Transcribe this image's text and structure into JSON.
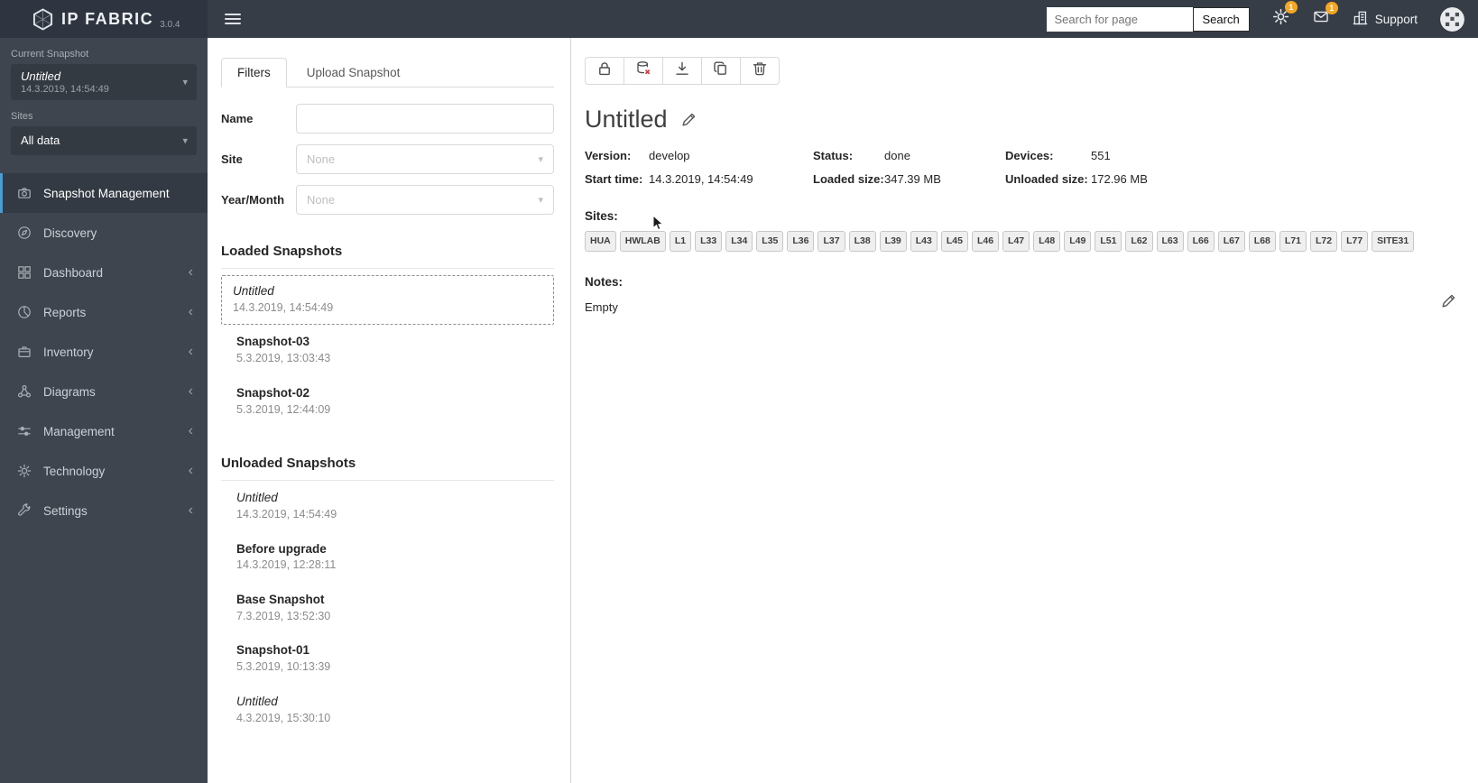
{
  "colors": {
    "accent": "#4a9bd5",
    "badge": "#f5a623",
    "danger": "#cf3b3b",
    "topbar_bg": "#363d46",
    "sidebar_bg": "#3e454e"
  },
  "icons": {
    "caret": "▾",
    "chevron": "‹"
  },
  "topbar": {
    "logo_text": "IP FABRIC",
    "version": "3.0.4",
    "search_placeholder": "Search for page",
    "search_button": "Search",
    "gear_badge": "1",
    "mail_badge": "1",
    "support_label": "Support"
  },
  "sidebar": {
    "current_snapshot_label": "Current Snapshot",
    "snapshot_select": {
      "name": "Untitled",
      "date": "14.3.2019, 14:54:49"
    },
    "sites_label": "Sites",
    "sites_select_value": "All data",
    "items": [
      {
        "label": "Snapshot Management"
      },
      {
        "label": "Discovery"
      },
      {
        "label": "Dashboard"
      },
      {
        "label": "Reports"
      },
      {
        "label": "Inventory"
      },
      {
        "label": "Diagrams"
      },
      {
        "label": "Management"
      },
      {
        "label": "Technology"
      },
      {
        "label": "Settings"
      }
    ]
  },
  "panel": {
    "tabs": [
      {
        "label": "Filters"
      },
      {
        "label": "Upload Snapshot"
      }
    ],
    "form": {
      "name_label": "Name",
      "site_label": "Site",
      "site_value": "None",
      "yearmonth_label": "Year/Month",
      "yearmonth_value": "None"
    },
    "loaded_heading": "Loaded Snapshots",
    "loaded": [
      {
        "name": "Untitled",
        "date": "14.3.2019, 14:54:49"
      },
      {
        "name": "Snapshot-03",
        "date": "5.3.2019, 13:03:43"
      },
      {
        "name": "Snapshot-02",
        "date": "5.3.2019, 12:44:09"
      }
    ],
    "unloaded_heading": "Unloaded Snapshots",
    "unloaded": [
      {
        "name": "Untitled",
        "date": "14.3.2019, 14:54:49"
      },
      {
        "name": "Before upgrade",
        "date": "14.3.2019, 12:28:11"
      },
      {
        "name": "Base Snapshot",
        "date": "7.3.2019, 13:52:30"
      },
      {
        "name": "Snapshot-01",
        "date": "5.3.2019, 10:13:39"
      },
      {
        "name": "Untitled",
        "date": "4.3.2019, 15:30:10"
      }
    ]
  },
  "main": {
    "title": "Untitled",
    "details": [
      {
        "label": "Version:",
        "value": "develop"
      },
      {
        "label": "Status:",
        "value": "done"
      },
      {
        "label": "Devices:",
        "value": "551"
      },
      {
        "label": "Start time:",
        "value": "14.3.2019, 14:54:49"
      },
      {
        "label": "Loaded size:",
        "value": "347.39 MB"
      },
      {
        "label": "Unloaded size:",
        "value": "172.96 MB"
      }
    ],
    "sites_heading": "Sites:",
    "site_tags": [
      "HUA",
      "HWLAB",
      "L1",
      "L33",
      "L34",
      "L35",
      "L36",
      "L37",
      "L38",
      "L39",
      "L43",
      "L45",
      "L46",
      "L47",
      "L48",
      "L49",
      "L51",
      "L62",
      "L63",
      "L66",
      "L67",
      "L68",
      "L71",
      "L72",
      "L77",
      "SITE31"
    ],
    "notes_heading": "Notes:",
    "notes_value": "Empty"
  }
}
